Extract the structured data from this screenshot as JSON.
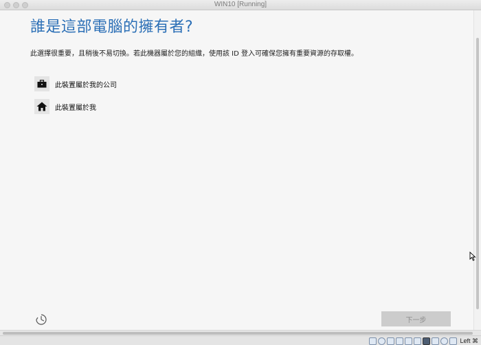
{
  "window": {
    "title": "WIN10 [Running]"
  },
  "setup": {
    "title": "誰是這部電腦的擁有者?",
    "description": "此選擇很重要，且稍後不易切換。若此機器屬於您的組織，使用該 ID 登入可確保您擁有重要資源的存取權。",
    "options": [
      {
        "label": "此裝置屬於我的公司",
        "icon": "briefcase-icon"
      },
      {
        "label": "此裝置屬於我",
        "icon": "home-icon"
      }
    ],
    "next_label": "下一步"
  },
  "statusbar": {
    "host_key": "Left ⌘"
  },
  "colors": {
    "accent": "#2b6fb6",
    "button_disabled": "#cccccc"
  }
}
